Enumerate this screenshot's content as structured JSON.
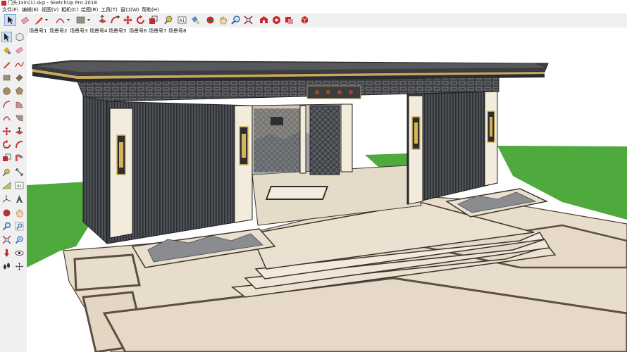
{
  "window": {
    "title": "门头1xin(1).skp - SketchUp Pro 2018"
  },
  "menu": [
    {
      "label": "文件(F)"
    },
    {
      "label": "编辑(E)"
    },
    {
      "label": "视图(V)"
    },
    {
      "label": "相机(C)"
    },
    {
      "label": "绘图(R)"
    },
    {
      "label": "工具(T)"
    },
    {
      "label": "窗口(W)"
    },
    {
      "label": "帮助(H)"
    }
  ],
  "scene_tabs": [
    {
      "label": "场景号1"
    },
    {
      "label": "场景号2"
    },
    {
      "label": "场景号3"
    },
    {
      "label": "场景号4"
    },
    {
      "label": "场景号5",
      "active": true
    },
    {
      "label": "场景号6"
    },
    {
      "label": "场景号7"
    },
    {
      "label": "场景号8"
    }
  ],
  "top_toolbar": [
    "select-icon",
    "eraser-icon",
    "pencil-icon",
    "arc-icon",
    "rectangle-icon",
    "push-pull-icon",
    "follow-me-icon",
    "move-icon",
    "rotate-icon",
    "scale-icon",
    "tape-measure-icon",
    "text-icon",
    "paint-bucket-icon",
    "orbit-icon",
    "pan-icon",
    "zoom-icon",
    "zoom-extents-icon",
    "warehouse-icon",
    "extension-icon",
    "component-icon",
    "ruby-icon"
  ],
  "left_toolbar": [
    "select-icon",
    "make-component-icon",
    "paint-bucket-icon",
    "eraser-icon",
    "line-icon",
    "freehand-icon",
    "rectangle-icon",
    "rotated-rectangle-icon",
    "circle-icon",
    "polygon-icon",
    "arc-icon",
    "pie-icon",
    "two-point-arc-icon",
    "three-point-arc-icon",
    "move-icon",
    "push-pull-icon",
    "rotate-icon",
    "follow-me-icon",
    "scale-icon",
    "offset-icon",
    "tape-measure-icon",
    "dimension-icon",
    "protractor-icon",
    "text-icon",
    "axes-icon",
    "3d-text-icon",
    "orbit-icon",
    "pan-icon",
    "zoom-icon",
    "zoom-window-icon",
    "zoom-extents-icon",
    "previous-view-icon",
    "position-camera-icon",
    "look-around-icon",
    "walk-icon",
    "section-plane-icon"
  ],
  "colors": {
    "ground": "#4faa3d",
    "paving": "#e8dccb",
    "roof": "#3b3d40",
    "frame": "#2b2e33",
    "panel": "#f3ecdc",
    "lamp": "#d4b45a",
    "background": "#ffffff"
  }
}
